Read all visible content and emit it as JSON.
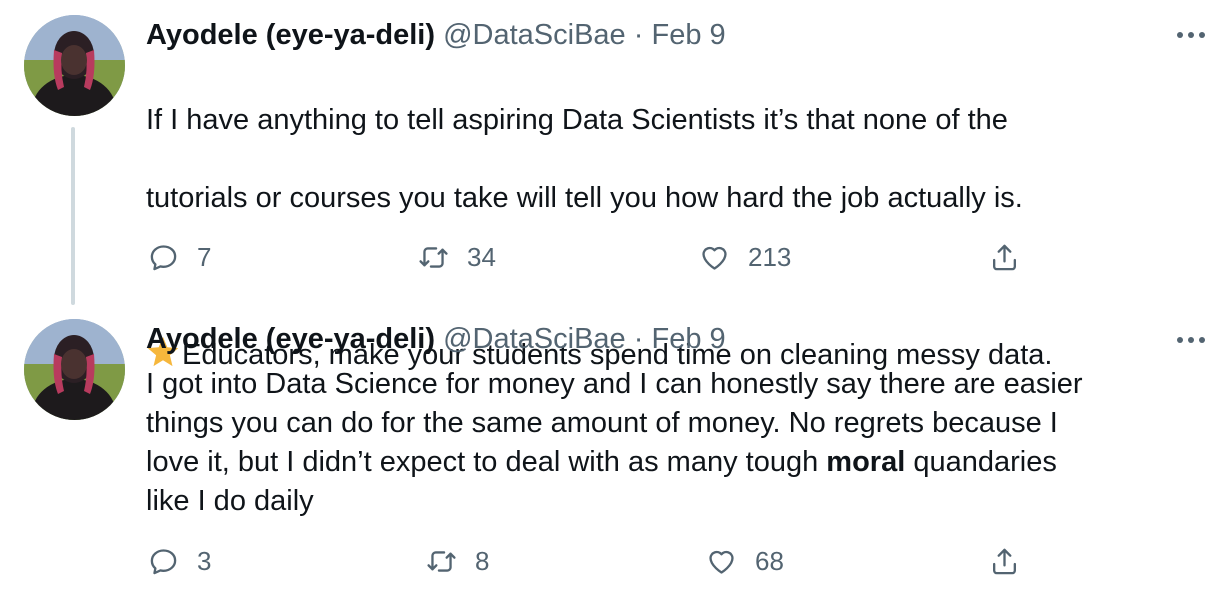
{
  "tweets": [
    {
      "author_name": "Ayodele (eye-ya-deli)",
      "handle": "@DataSciBae",
      "separator": "·",
      "date": "Feb 9",
      "text_lines": [
        "If I have anything to tell aspiring Data Scientists it’s that none of the",
        "tutorials or courses you take will tell you how hard the job actually is."
      ],
      "emoji_line": "Educators, make your students spend time on cleaning messy data.",
      "reply_count": "7",
      "retweet_count": "34",
      "like_count": "213"
    },
    {
      "author_name": "Ayodele (eye-ya-deli)",
      "handle": "@DataSciBae",
      "separator": "·",
      "date": "Feb 9",
      "text_part1": "I got into Data Science for money and I can honestly say there are easier\nthings you can do for the same amount of money. No regrets because I\nlove it, but I didn’t expect to deal with as many tough ",
      "text_bold": "moral",
      "text_part2": " quandaries\nlike I do daily",
      "reply_count": "3",
      "retweet_count": "8",
      "like_count": "68"
    }
  ],
  "colors": {
    "text_primary": "#0f1419",
    "text_secondary": "#536471",
    "thread_line": "#cfd9de",
    "star": "#f6b73c"
  },
  "icons": [
    "reply-icon",
    "retweet-icon",
    "like-icon",
    "share-icon",
    "more-icon",
    "star-icon"
  ]
}
